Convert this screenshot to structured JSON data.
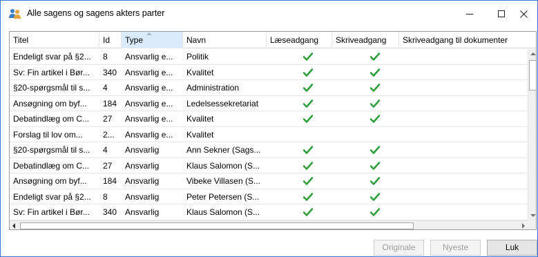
{
  "window": {
    "title": "Alle sagens og sagens akters parter",
    "accent": "#2b79d8"
  },
  "grid": {
    "columns": [
      {
        "key": "titel",
        "label": "Titel"
      },
      {
        "key": "id",
        "label": "Id"
      },
      {
        "key": "type",
        "label": "Type",
        "sorted": "ascending"
      },
      {
        "key": "navn",
        "label": "Navn"
      },
      {
        "key": "laes",
        "label": "Læseadgang"
      },
      {
        "key": "skriv",
        "label": "Skriveadgang"
      },
      {
        "key": "skrivdok",
        "label": "Skriveadgang til dokumenter"
      }
    ],
    "rows": [
      {
        "titel": "Endeligt svar på §2...",
        "id": "8",
        "type": "Ansvarlig e...",
        "navn": "Politik",
        "laes": true,
        "skriv": true
      },
      {
        "titel": "Sv: Fin artikel i Bør...",
        "id": "340",
        "type": "Ansvarlig e...",
        "navn": "Kvalitet",
        "laes": true,
        "skriv": true
      },
      {
        "titel": "§20-spørgsmål til s...",
        "id": "4",
        "type": "Ansvarlig e...",
        "navn": "Administration",
        "laes": true,
        "skriv": true
      },
      {
        "titel": "Ansøgning om byf...",
        "id": "184",
        "type": "Ansvarlig e...",
        "navn": "Ledelsessekretariat",
        "laes": true,
        "skriv": true
      },
      {
        "titel": "Debatindlæg om C...",
        "id": "27",
        "type": "Ansvarlig e...",
        "navn": "Kvalitet",
        "laes": true,
        "skriv": true
      },
      {
        "titel": "Forslag til lov om...",
        "id": "2...",
        "type": "Ansvarlig e...",
        "navn": "Kvalitet",
        "laes": false,
        "skriv": false
      },
      {
        "titel": "§20-spørgsmål til s...",
        "id": "4",
        "type": "Ansvarlig",
        "navn": "Ann Sekner (Sags...",
        "laes": true,
        "skriv": true
      },
      {
        "titel": "Debatindlæg om C...",
        "id": "27",
        "type": "Ansvarlig",
        "navn": "Klaus Salomon (S...",
        "laes": true,
        "skriv": true
      },
      {
        "titel": "Ansøgning om byf...",
        "id": "184",
        "type": "Ansvarlig",
        "navn": "Vibeke Villasen (S...",
        "laes": true,
        "skriv": true
      },
      {
        "titel": "Endeligt svar på §2...",
        "id": "8",
        "type": "Ansvarlig",
        "navn": "Peter Petersen (S...",
        "laes": true,
        "skriv": true
      },
      {
        "titel": "Sv: Fin artikel i Bør...",
        "id": "340",
        "type": "Ansvarlig",
        "navn": "Klaus Salomon (S...",
        "laes": true,
        "skriv": true
      }
    ],
    "check_icon": "checkmark-icon",
    "check_color": "#2e9e3a"
  },
  "buttons": {
    "originale": "Originale",
    "nyeste": "Nyeste",
    "luk": "Luk"
  }
}
